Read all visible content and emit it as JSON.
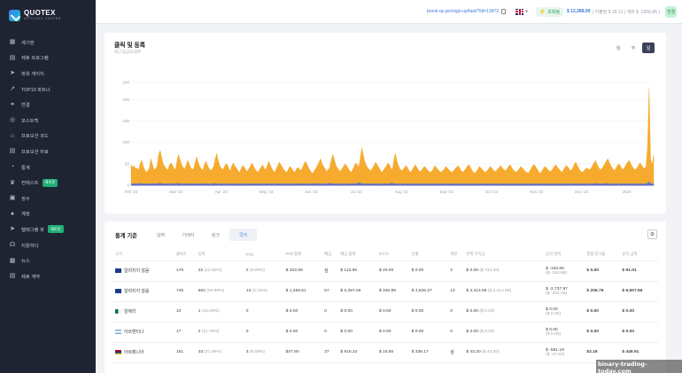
{
  "brand": {
    "title": "QUOTEX",
    "subtitle": "AFFILIATE CENTER"
  },
  "sidebar": {
    "items": [
      {
        "label": "계기판",
        "icon": "dashboard-icon"
      },
      {
        "label": "제휴 프로그램",
        "icon": "folder-icon"
      },
      {
        "label": "파워 게이지",
        "icon": "send-icon"
      },
      {
        "label": "TOP10 파트너",
        "icon": "trending-icon"
      },
      {
        "label": "연결",
        "icon": "link-icon"
      },
      {
        "label": "포스트백",
        "icon": "target-icon"
      },
      {
        "label": "프로모션 코드",
        "icon": "tag-icon"
      },
      {
        "label": "프로모션 자료",
        "icon": "document-icon"
      },
      {
        "label": "통계",
        "icon": "pie-chart-icon"
      },
      {
        "label": "컨테스트",
        "icon": "trophy-icon",
        "badge": "새로운"
      },
      {
        "label": "정수",
        "icon": "wallet-icon"
      },
      {
        "label": "계정",
        "icon": "user-icon"
      },
      {
        "label": "텔레그램 봇",
        "icon": "telegram-icon",
        "badge": "새로운"
      },
      {
        "label": "지원하다",
        "icon": "support-icon"
      },
      {
        "label": "뉴스",
        "icon": "news-icon"
      },
      {
        "label": "제휴 계약",
        "icon": "contract-icon"
      }
    ]
  },
  "topbar": {
    "ref_link": "brook-qx.pro/sign-up/fast/?lid=13472",
    "balance_status": "조회됨",
    "balance": "$ 12,388.09",
    "balance_detail": "( 지불된 $ 18.12 | 계좌 $ -2306.85 )",
    "id_label": "연결"
  },
  "chart_card": {
    "title": "클릭 및 등록",
    "subtitle": "최근 등급의 화주",
    "range_tabs": [
      "월",
      "주",
      "일"
    ],
    "active_range": 2
  },
  "chart_data": {
    "type": "area",
    "title": "클릭 및 등록",
    "x_ticks": [
      "Feb '23",
      "Mar '23",
      "Apr '23",
      "May '23",
      "Jun '23",
      "Jul '23",
      "Aug '23",
      "Sep '23",
      "Oct '23",
      "Nov '23",
      "Dec '23",
      "2024"
    ],
    "y_ticks": [
      0,
      50,
      100,
      150,
      200,
      240
    ],
    "ylim": [
      0,
      240
    ],
    "grid": true,
    "series": [
      {
        "color": "#f5a623",
        "values": [
          48,
          42,
          45,
          38,
          40,
          35,
          52,
          58,
          44,
          36,
          30,
          34,
          40,
          62,
          48,
          36,
          38,
          45,
          70,
          82,
          65,
          50,
          44,
          39,
          35,
          46,
          52,
          48,
          40,
          36,
          55,
          72,
          60,
          48,
          42,
          38,
          46,
          58,
          50,
          42,
          36,
          40,
          54,
          66,
          52,
          44,
          38,
          35,
          48,
          56,
          46,
          40,
          34,
          37,
          44,
          60,
          74,
          58,
          46,
          40,
          36,
          42,
          50,
          48,
          38,
          34,
          46,
          52,
          44,
          40,
          34,
          30,
          38,
          46,
          42,
          36,
          32,
          38,
          44,
          52,
          46,
          38,
          34,
          30,
          36,
          42,
          48,
          40,
          36,
          44,
          56,
          48,
          40,
          34,
          30,
          38,
          46,
          54,
          48,
          42,
          36,
          32,
          30,
          38,
          44,
          40,
          34,
          30,
          36,
          42,
          38,
          34,
          40,
          48,
          56,
          50,
          42,
          36,
          30,
          28,
          34,
          40,
          46,
          54,
          62,
          50,
          44,
          38,
          32,
          36,
          42,
          58,
          72,
          60,
          48,
          40,
          36,
          32,
          38,
          44,
          50,
          46,
          40,
          34,
          30,
          36,
          44,
          52,
          48,
          42,
          62,
          88,
          70,
          54,
          46,
          40,
          36,
          34,
          40,
          46,
          54,
          48,
          42,
          36,
          30,
          34,
          40,
          44,
          52,
          48,
          40,
          36,
          60,
          74,
          56,
          46,
          38,
          34,
          36,
          42,
          46,
          40,
          34,
          30,
          36,
          42,
          48,
          42,
          36,
          32,
          34,
          40,
          44,
          40,
          36,
          32,
          30,
          34,
          40,
          46,
          40,
          36,
          32,
          30,
          34,
          38,
          44,
          40,
          36,
          32,
          30,
          34,
          38,
          42,
          46,
          40,
          34,
          30,
          34,
          38,
          44,
          48,
          42,
          36,
          30,
          28,
          32,
          38,
          44,
          40,
          36,
          32,
          30,
          34,
          38,
          44,
          40,
          36,
          32,
          34,
          38,
          42,
          46,
          40,
          36,
          34,
          38,
          44,
          48,
          42,
          36,
          32,
          30,
          34,
          38,
          44,
          40,
          36,
          32,
          30,
          28,
          34,
          40,
          46,
          48,
          42,
          36,
          30,
          28,
          34,
          40,
          44,
          40,
          36,
          32,
          34,
          38,
          44,
          48,
          42,
          38,
          34,
          30,
          36,
          42,
          46,
          42,
          36,
          34,
          40,
          48,
          54,
          46,
          40,
          34,
          30,
          32,
          36,
          40,
          38,
          36,
          40,
          46,
          52,
          58,
          48,
          42,
          36,
          38,
          44,
          50,
          56,
          62,
          52,
          46,
          40,
          34,
          38,
          44,
          50,
          46,
          40,
          36,
          42,
          48,
          54,
          58,
          50,
          44,
          38,
          36,
          40,
          46,
          52,
          48,
          42,
          38,
          44,
          90,
          225,
          60,
          48,
          70
        ]
      },
      {
        "color": "#3d79d8",
        "values": [
          3,
          3,
          4,
          3,
          3,
          3,
          4,
          4,
          3,
          3,
          3,
          3,
          3,
          4,
          3,
          3,
          3,
          3,
          4,
          5,
          4,
          3,
          3,
          3,
          3,
          3,
          4,
          3,
          3,
          3,
          4,
          4,
          4,
          3,
          3,
          3,
          3,
          4,
          3,
          3,
          3,
          3,
          3,
          4,
          3,
          3,
          3,
          3,
          3,
          4,
          3,
          3,
          3,
          3,
          3,
          4,
          4,
          3,
          3,
          3,
          3,
          3,
          3,
          3,
          3,
          3,
          3,
          3,
          3,
          3,
          3,
          3,
          3,
          3,
          3,
          3,
          3,
          3,
          3,
          4,
          3,
          3,
          3,
          3,
          3,
          3,
          3,
          3,
          3,
          3,
          4,
          3,
          3,
          3,
          3,
          3,
          3,
          4,
          3,
          3,
          3,
          3,
          3,
          3,
          3,
          3,
          3,
          3,
          3,
          3,
          3,
          3,
          3,
          3,
          4,
          3,
          3,
          3,
          3,
          3,
          3,
          3,
          3,
          4,
          4,
          3,
          3,
          3,
          3,
          3,
          3,
          4,
          5,
          4,
          3,
          3,
          3,
          3,
          3,
          3,
          3,
          3,
          3,
          3,
          3,
          3,
          3,
          4,
          3,
          3,
          4,
          6,
          5,
          4,
          3,
          3,
          3,
          3,
          3,
          3,
          4,
          3,
          3,
          3,
          3,
          3,
          3,
          3,
          4,
          3,
          3,
          3,
          4,
          5,
          4,
          3,
          3,
          3,
          3,
          3,
          3,
          3,
          3,
          3,
          3,
          3,
          3,
          3,
          3,
          3,
          3,
          3,
          3,
          3,
          3,
          3,
          3,
          3,
          3,
          3,
          3,
          3,
          3,
          3,
          3,
          3,
          3,
          3,
          3,
          3,
          3,
          3,
          3,
          3,
          3,
          3,
          3,
          3,
          3,
          3,
          3,
          3,
          3,
          3,
          3,
          3,
          3,
          3,
          3,
          3,
          3,
          3,
          3,
          3,
          3,
          3,
          3,
          3,
          3,
          3,
          3,
          3,
          3,
          3,
          3,
          3,
          3,
          3,
          3,
          3,
          3,
          3,
          3,
          3,
          3,
          3,
          3,
          3,
          3,
          3,
          3,
          3,
          3,
          3,
          3,
          3,
          3,
          3,
          3,
          3,
          3,
          3,
          3,
          3,
          3,
          3,
          3,
          3,
          3,
          3,
          3,
          3,
          3,
          3,
          3,
          3,
          3,
          3,
          3,
          3,
          3,
          3,
          3,
          3,
          3,
          4,
          3,
          3,
          3,
          3,
          3,
          3,
          3,
          3,
          3,
          3,
          3,
          3,
          4,
          4,
          3,
          3,
          3,
          3,
          3,
          4,
          4,
          4,
          3,
          3,
          3,
          3,
          3,
          3,
          3,
          3,
          3,
          3,
          3,
          3,
          3,
          4,
          3,
          3,
          3,
          3,
          3,
          3,
          3,
          3,
          3,
          3,
          3,
          5,
          8,
          4,
          3,
          4
        ]
      }
    ]
  },
  "stats": {
    "title": "통계 기준",
    "tabs": [
      "날짜",
      "거래자",
      "링크",
      "국가"
    ],
    "active_tab": 3,
    "columns": [
      "국가",
      "클릭수",
      "등록",
      "FTD",
      "FTD 합계",
      "예금",
      "예금 합계",
      "보너스",
      "인출",
      "위원",
      "잔액 수익금",
      "순익 변화",
      "통합 잔고율",
      "순익 금액"
    ],
    "rows": [
      {
        "flag": "au",
        "country": "알려지지 않음",
        "clicks": "176",
        "reg": "22",
        "reg_pct": "(12.50%)",
        "ftd": "2",
        "ftd_pct": "(9.09%)",
        "ftd_sum": "$ 103.89",
        "deposits": "삼",
        "dep_sum": "$ 113.89",
        "bonus": "$ 40.00",
        "withdraw": "$ 0.00",
        "commission": "2",
        "balance": "$ 0.00",
        "balance_sub": "($ 744.33)",
        "net": "$ -153.66",
        "net_sub": "($ -153.66)",
        "rate": "$ 0.00",
        "profit": "$ 91.01"
      },
      {
        "flag": "au",
        "country": "알려지지 않음",
        "clicks": "745",
        "reg": "602",
        "reg_pct": "(94.98%)",
        "ftd": "13",
        "ftd_pct": "(2.16%)",
        "ftd_sum": "$ 1,265.51",
        "deposits": "57",
        "dep_sum": "$ 5,397.56",
        "bonus": "$ 346.89",
        "withdraw": "$ 4,535.27",
        "commission": "13",
        "balance": "$ 2,414.96",
        "balance_sub": "($ 2,414.96)",
        "net": "$ -2,737.97",
        "net_sub": "($ -201.45)",
        "rate": "$ 205.79",
        "profit": "$ 9,507.66"
      },
      {
        "flag": "bh",
        "country": "알제리",
        "clicks": "10",
        "reg": "1",
        "reg_pct": "(10.00%)",
        "ftd": "0",
        "ftd_pct": "",
        "ftd_sum": "$ 0.00",
        "deposits": "0",
        "dep_sum": "$ 0.00",
        "bonus": "$ 0.00",
        "withdraw": "$ 0.00",
        "commission": "0",
        "balance": "$ 0.00",
        "balance_sub": "($ 0.00)",
        "net": "$ 0.00",
        "net_sub": "($ 0.00)",
        "rate": "$ 0.00",
        "profit": "$ 0.00"
      },
      {
        "flag": "ar",
        "country": "아르헨티나",
        "clicks": "17",
        "reg": "2",
        "reg_pct": "(11.76%)",
        "ftd": "0",
        "ftd_pct": "",
        "ftd_sum": "$ 0.00",
        "deposits": "0",
        "dep_sum": "$ 0.00",
        "bonus": "$ 0.00",
        "withdraw": "$ 0.00",
        "commission": "0",
        "balance": "$ 0.00",
        "balance_sub": "($ 0.00)",
        "net": "$ 0.00",
        "net_sub": "($ 0.00)",
        "rate": "$ 0.00",
        "profit": "$ 0.00"
      },
      {
        "flag": "am",
        "country": "아르메니아",
        "clicks": "151",
        "reg": "33",
        "reg_pct": "(21.85%)",
        "ftd": "3",
        "ftd_pct": "(9.09%)",
        "ftd_sum": "$47.90",
        "deposits": "37",
        "dep_sum": "$ 918.22",
        "bonus": "$ 15.80",
        "withdraw": "$ 338.17",
        "commission": "삼",
        "balance": "$ 43.20",
        "balance_sub": "($ 43.20)",
        "net": "$ -561.19",
        "net_sub": "($ -17.82)",
        "rate": "$2.16",
        "profit": "$ 448.91"
      }
    ]
  },
  "watermark": "binary-trading-today.com"
}
